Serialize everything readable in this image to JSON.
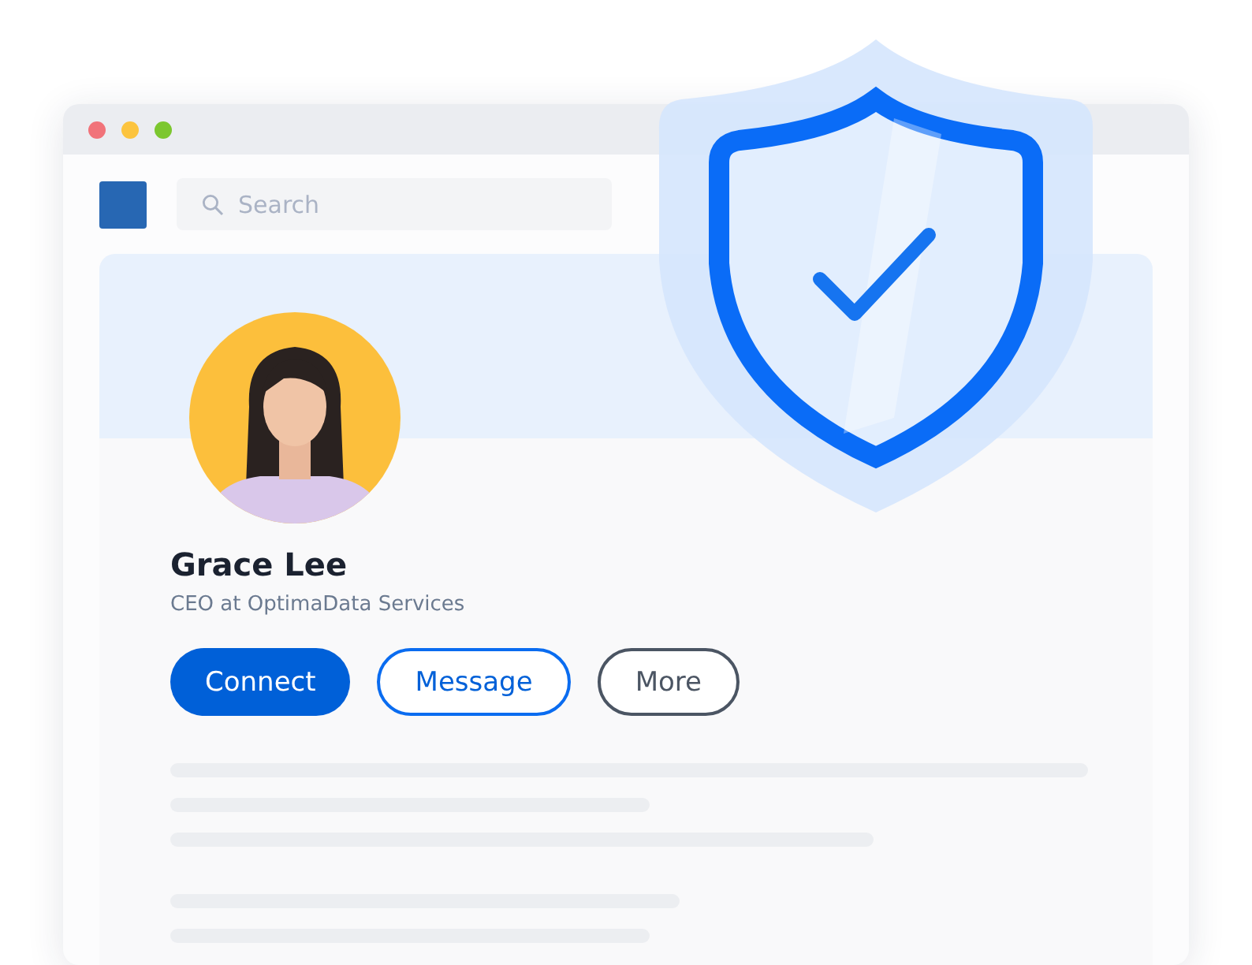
{
  "search": {
    "placeholder": "Search"
  },
  "profile": {
    "name": "Grace Lee",
    "headline": "CEO at OptimaData Services"
  },
  "buttons": [
    {
      "label": "Connect",
      "kind": "primary"
    },
    {
      "label": "Message",
      "kind": "outline"
    },
    {
      "label": "More",
      "kind": "secondary"
    }
  ]
}
